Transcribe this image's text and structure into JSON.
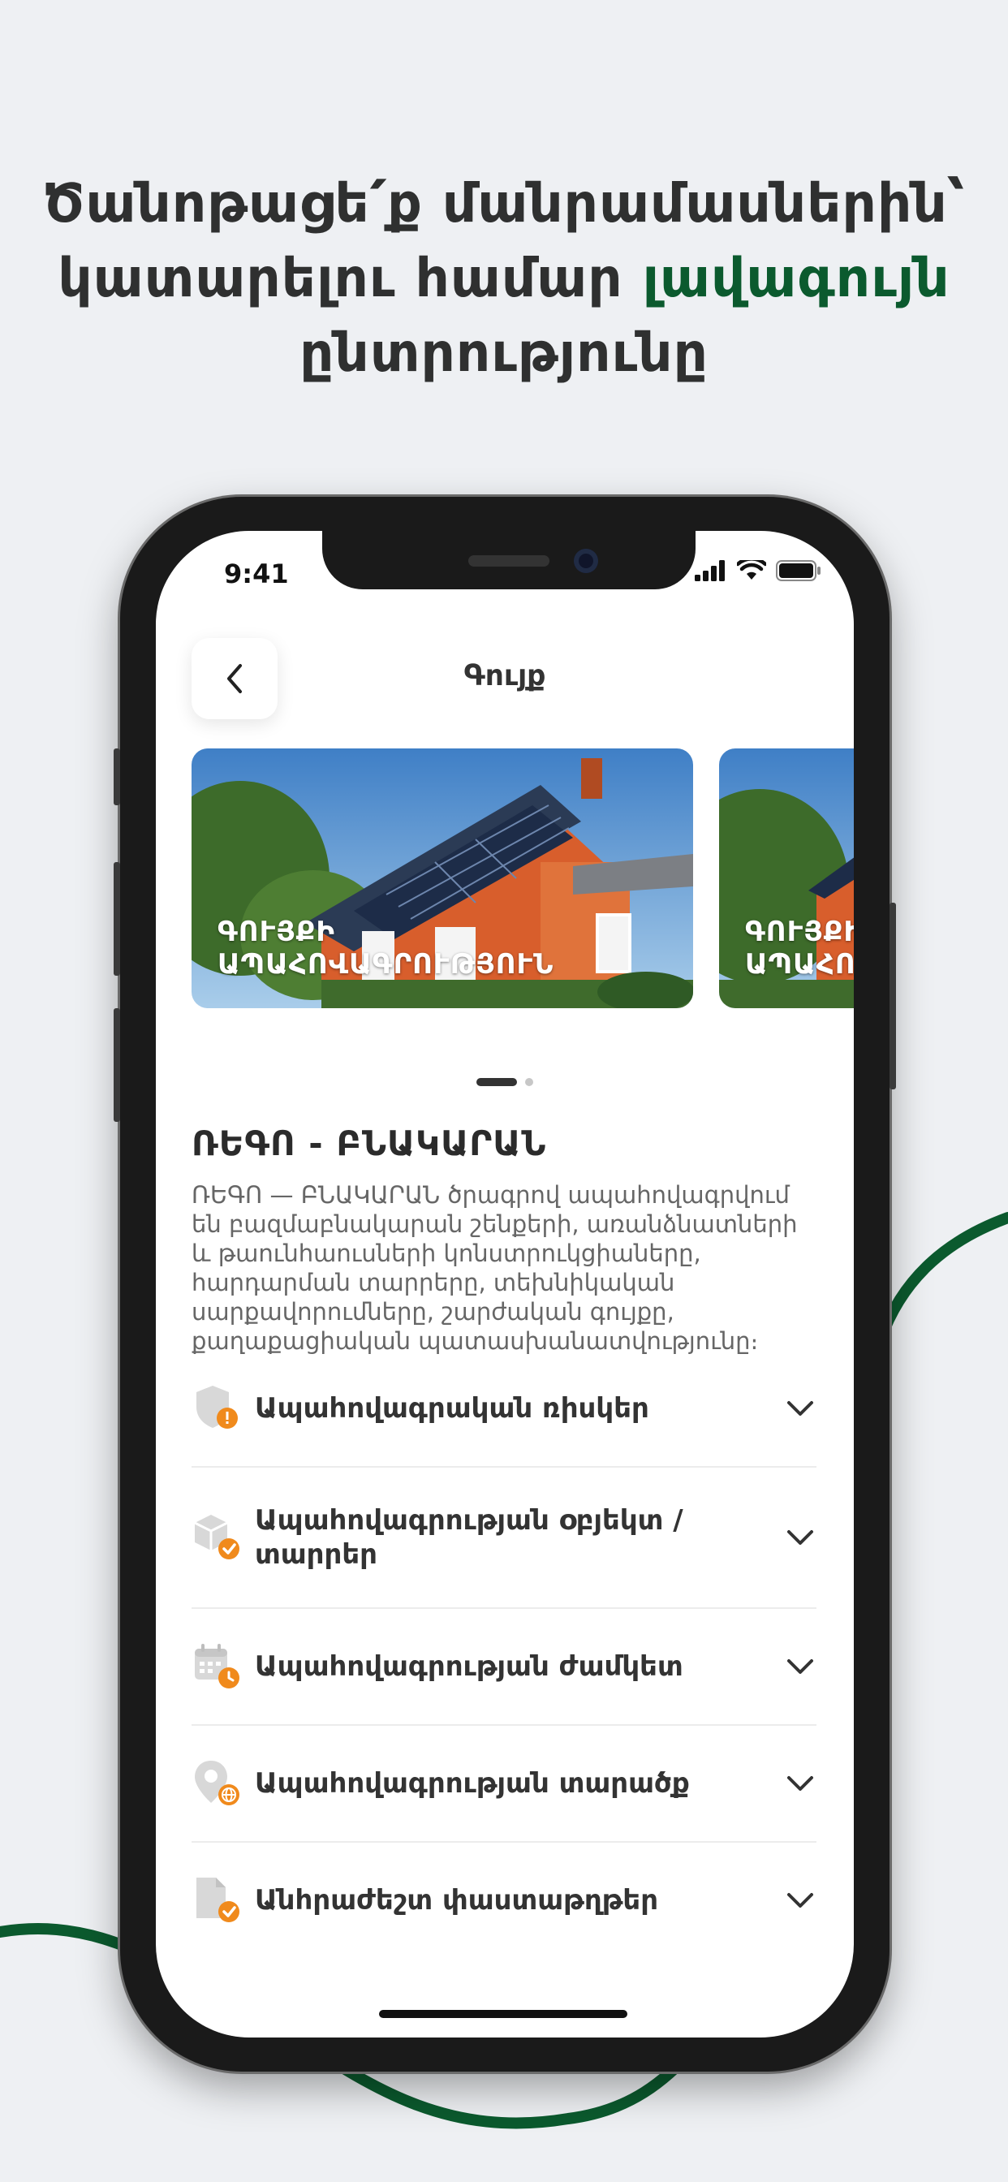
{
  "headline": {
    "line1": "Ծանոթացե՛ք մանրամասներին՝",
    "line2_start": "կատարելու համար ",
    "line2_accent": "լավագույն",
    "line3": "ընտրությունը"
  },
  "status_bar": {
    "time": "9:41"
  },
  "screen": {
    "title": "Գույք",
    "banners": [
      {
        "caption_line1": "ԳՈՒՅՔԻ",
        "caption_line2": "ԱՊԱՀՈՎԱԳՐՈՒԹՅՈՒՆ"
      },
      {
        "caption_line1": "ԳՈՒՅՔԻ",
        "caption_line2": "ԱՊԱՀՈ"
      }
    ],
    "section_title": "ՌԵԳՈ - ԲՆԱԿԱՐԱՆ",
    "section_desc": "ՌԵԳՈ — ԲՆԱԿԱՐԱՆ ծրագրով ապահովագրվում են բազմաբնակարան շենքերի, առանձնատների և թաունհաուսների կոնստրուկցիաները, հարդարման տարրերը, տեխնիկական սարքավորումները, շարժական գույքը, քաղաքացիական պատասխանատվությունը։",
    "rows": [
      {
        "label": "Ապահովագրական ռիսկեր",
        "icon": "shield-warning-icon"
      },
      {
        "label": "Ապահովագրության օբյեկտ / տարրեր",
        "icon": "box-check-icon"
      },
      {
        "label": "Ապահովագրության ժամկետ",
        "icon": "calendar-clock-icon"
      },
      {
        "label": "Ապահովագրության տարածք",
        "icon": "location-globe-icon"
      },
      {
        "label": "Անհրաժեշտ փաստաթղթեր",
        "icon": "document-check-icon"
      }
    ]
  },
  "colors": {
    "accent_green": "#0b5a2e",
    "badge_orange": "#f08a1c",
    "background": "#eef0f3"
  }
}
